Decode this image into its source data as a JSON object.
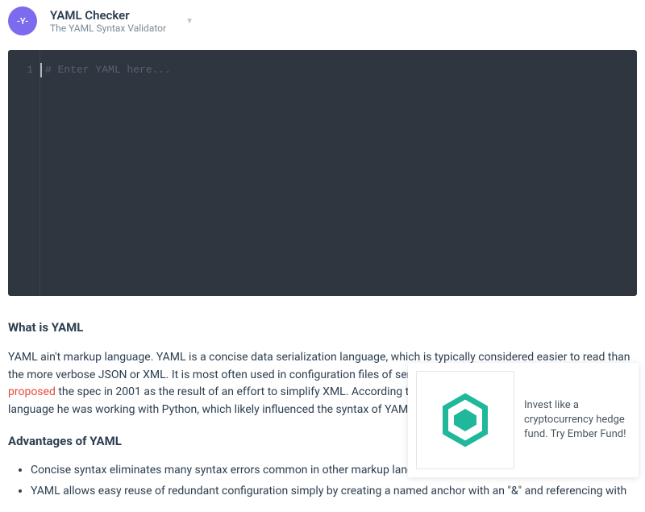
{
  "header": {
    "logo_text": "-Y-",
    "title": "YAML Checker",
    "subtitle": "The YAML Syntax Validator"
  },
  "editor": {
    "line_number": "1",
    "placeholder": "# Enter YAML here..."
  },
  "content": {
    "heading1": "What is YAML",
    "para1a": "YAML ain't markup language. YAML is a concise data serialization language, which is typically considered easier to read than the more verbose JSON or XML. It is most often used in configuration files of servers and software applications. Clark Evans ",
    "link1": "proposed",
    "para1b": " the spec in 2001 as the result of an effort to simplify XML. According to his resume, at the time he developed the language he was working with Python, which likely influenced the syntax of YAML as an indentation-based language.",
    "heading2": "Advantages of YAML",
    "bullet1": "Concise syntax eliminates many syntax errors common in other markup languages",
    "bullet2": "YAML allows easy reuse of redundant configuration simply by creating a named anchor with an \"&\" and referencing with"
  },
  "ad": {
    "text": "Invest like a cryptocurrency hedge fund. Try Ember Fund!"
  },
  "colors": {
    "logo_bg": "#7c6aef",
    "editor_bg": "#2f3640",
    "link": "#e74c3c",
    "ad_icon": "#1fb89a"
  }
}
